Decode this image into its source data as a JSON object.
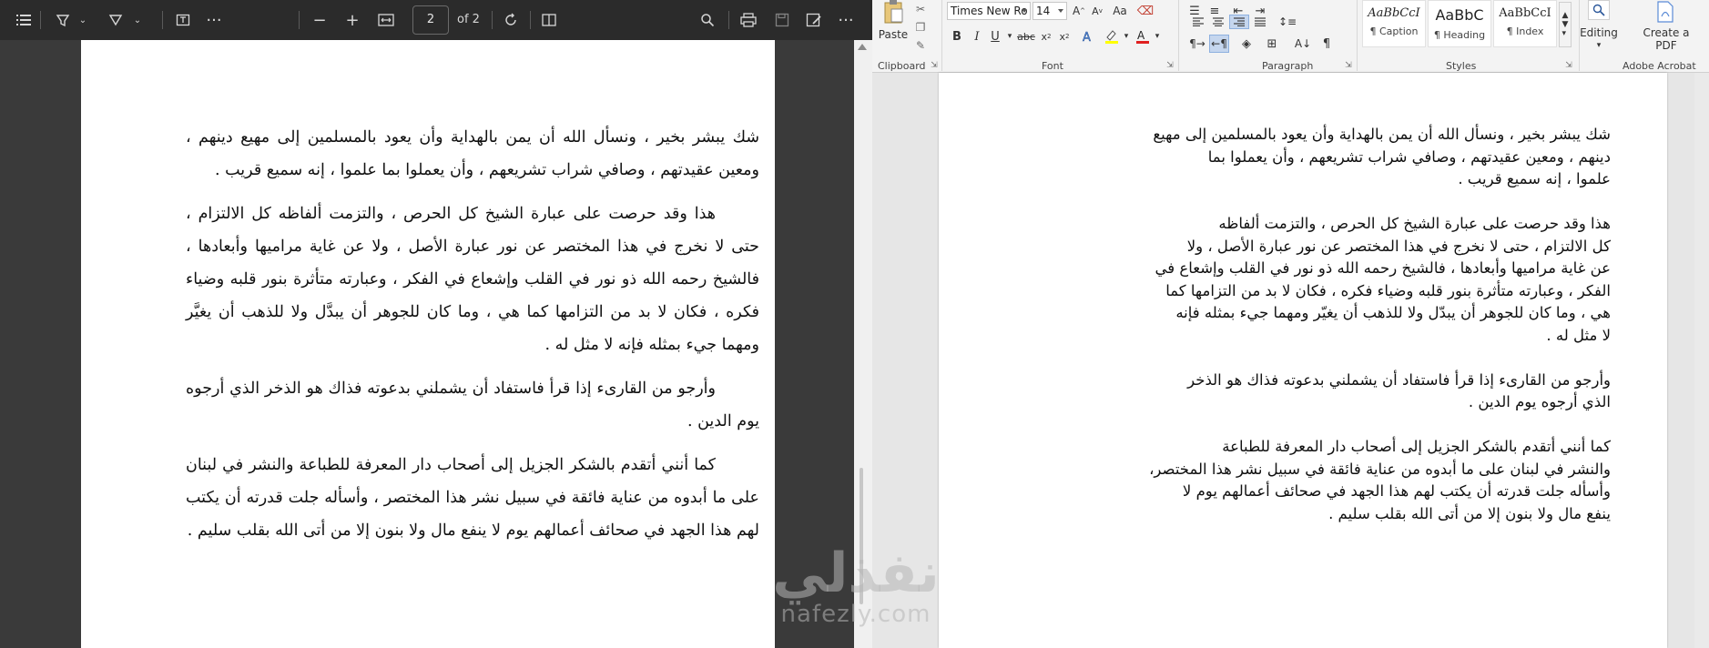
{
  "pdf_viewer": {
    "page_current": "2",
    "page_total_label": "of 2",
    "paragraphs": [
      "شك يبشر بخير ، ونسأل الله أن يمن بالهداية وأن يعود بالمسلمين إلى مهيع دينهم ، ومعين عقيدتهم ، وصافي شراب تشريعهم ، وأن يعملوا بما علموا ، إنه سميع قريب .",
      "هذا وقد حرصت على عبارة الشيخ كل الحرص ، والتزمت ألفاظه كل الالتزام ، حتى لا نخرج في هذا المختصر عن نور عبارة الأصل ، ولا عن غاية مراميها وأبعادها ، فالشيخ رحمه الله ذو نور في القلب وإشعاع في الفكر ، وعبارته متأثرة بنور قلبه وضياء فكره ، فكان لا بد من التزامها كما هي ، وما كان للجوهر أن يبدَّل ولا للذهب أن يغيَّر ومهما جيء بمثله فإنه لا مثل له .",
      "وأرجو من القارىء إذا قرأ فاستفاد أن يشملني بدعوته فذاك هو الذخر الذي أرجوه يوم الدين .",
      "كما أنني أتقدم بالشكر الجزيل إلى أصحاب دار المعرفة للطباعة والنشر في لبنان على ما أبدوه من عناية فائقة في سبيل نشر هذا المختصر ، وأسأله جلت قدرته أن يكتب لهم هذا الجهد في صحائف أعمالهم يوم لا ينفع مال ولا بنون إلا من أتى الله بقلب سليم ."
    ]
  },
  "word": {
    "ribbon": {
      "paste_label": "Paste",
      "font_name": "Times New Ro",
      "font_size": "14",
      "styles": [
        {
          "sample": "AaBbCcI",
          "name": "¶ Caption"
        },
        {
          "sample": "AaBbC",
          "name": "¶ Heading"
        },
        {
          "sample": "AaBbCcI",
          "name": "¶ Index"
        }
      ],
      "editing_label": "Editing",
      "create_pdf_label": "Create a PDF",
      "groups": {
        "clipboard": "Clipboard",
        "font": "Font",
        "paragraph": "Paragraph",
        "styles": "Styles",
        "acrobat": "Adobe Acrobat"
      }
    },
    "document_lines": [
      [
        "شك يبشر بخير ، ونسأل الله أن يمن بالهداية وأن يعود بالمسلمين إلى مهيع",
        "دينهم ، ومعين عقيدتهم ، وصافي شراب تشريعهم ، وأن يعملوا بما",
        "علموا ، إنه سميع قريب ."
      ],
      [
        "هذا وقد حرصت على عبارة الشيخ كل الحرص ، والتزمت ألفاظه",
        "كل الالتزام ، حتى لا نخرج في هذا المختصر عن نور عبارة الأصل ، ولا",
        "عن غاية مراميها وأبعادها ، فالشيخ رحمه الله ذو نور في القلب وإشعاع في",
        "الفكر ، وعبارته متأثرة بنور قلبه وضياء فكره ، فكان لا بد من التزامها كما",
        "هي ، وما كان للجوهر أن يبدّل ولا للذهب أن يغيّر ومهما جيء بمثله فإنه",
        "لا مثل له ."
      ],
      [
        "وأرجو من القارىء إذا قرأ فاستفاد أن يشملني بدعوته فذاك هو الذخر",
        "الذي أرجوه يوم الدين ."
      ],
      [
        "كما أنني أتقدم بالشكر الجزيل إلى أصحاب دار المعرفة للطباعة",
        "والنشر في لبنان على ما أبدوه من عناية فائقة في سبيل نشر هذا المختصر،",
        "وأسأله جلت قدرته أن يكتب لهم هذا الجهد في صحائف أعمالهم يوم لا",
        "ينفع مال ولا بنون إلا من أتى الله بقلب سليم ."
      ]
    ]
  },
  "watermark": {
    "arabic": "نفذلي",
    "latin": "nafezly.com"
  },
  "colors": {
    "pdf_toolbar_bg": "#2b2b2b",
    "pdf_canvas_bg": "#3a3a3a",
    "word_ribbon_bg": "#f3f3f3",
    "word_canvas_bg": "#e6e6e6",
    "word_icon_blue": "#2b579a"
  }
}
